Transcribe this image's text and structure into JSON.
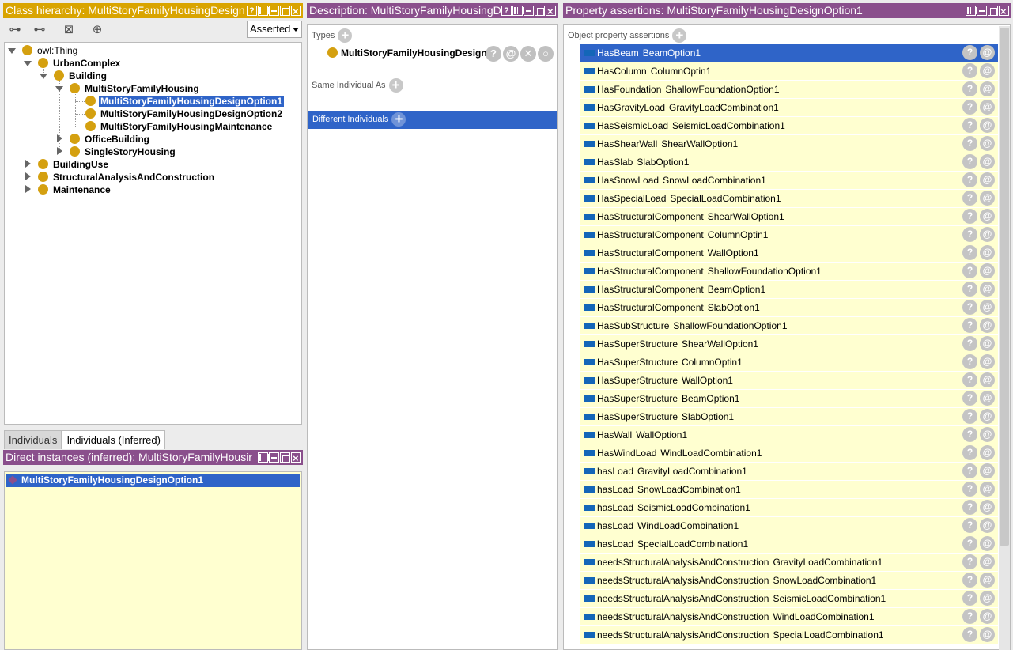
{
  "class_panel": {
    "title": "Class hierarchy: MultiStoryFamilyHousingDesign",
    "mode_select": "Asserted",
    "tree": [
      {
        "label": "owl:Thing",
        "depth": 0
      },
      {
        "label": "UrbanComplex",
        "depth": 1
      },
      {
        "label": "Building",
        "depth": 2
      },
      {
        "label": "MultiStoryFamilyHousing",
        "depth": 3
      },
      {
        "label": "MultiStoryFamilyHousingDesignOption1",
        "depth": 4
      },
      {
        "label": "MultiStoryFamilyHousingDesignOption2",
        "depth": 4
      },
      {
        "label": "MultiStoryFamilyHousingMaintenance",
        "depth": 4
      },
      {
        "label": "OfficeBuilding",
        "depth": 3
      },
      {
        "label": "SingleStoryHousing",
        "depth": 3
      },
      {
        "label": "BuildingUse",
        "depth": 1
      },
      {
        "label": "StructuralAnalysisAndConstruction",
        "depth": 1
      },
      {
        "label": "Maintenance",
        "depth": 1
      }
    ]
  },
  "individual_tabs": [
    "Individuals",
    "Individuals (Inferred)"
  ],
  "direct_panel": {
    "title": "Direct instances (inferred): MultiStoryFamilyHousir",
    "instance": "MultiStoryFamilyHousingDesignOption1"
  },
  "description_panel": {
    "title": "Description: MultiStoryFamilyHousingD",
    "types_label": "Types",
    "type_value": "MultiStoryFamilyHousingDesignO",
    "same_label": "Same Individual As",
    "different_label": "Different Individuals"
  },
  "property_panel": {
    "title": "Property assertions: MultiStoryFamilyHousingDesignOption1",
    "section_label": "Object property assertions",
    "rows": [
      {
        "prop": "HasBeam",
        "value": "BeamOption1"
      },
      {
        "prop": "HasColumn",
        "value": "ColumnOptin1"
      },
      {
        "prop": "HasFoundation",
        "value": "ShallowFoundationOption1"
      },
      {
        "prop": "HasGravityLoad",
        "value": "GravityLoadCombination1"
      },
      {
        "prop": "HasSeismicLoad",
        "value": "SeismicLoadCombination1"
      },
      {
        "prop": "HasShearWall",
        "value": "ShearWallOption1"
      },
      {
        "prop": "HasSlab",
        "value": "SlabOption1"
      },
      {
        "prop": "HasSnowLoad",
        "value": "SnowLoadCombination1"
      },
      {
        "prop": "HasSpecialLoad",
        "value": "SpecialLoadCombination1"
      },
      {
        "prop": "HasStructuralComponent",
        "value": "ShearWallOption1"
      },
      {
        "prop": "HasStructuralComponent",
        "value": "ColumnOptin1"
      },
      {
        "prop": "HasStructuralComponent",
        "value": "WallOption1"
      },
      {
        "prop": "HasStructuralComponent",
        "value": "ShallowFoundationOption1"
      },
      {
        "prop": "HasStructuralComponent",
        "value": "BeamOption1"
      },
      {
        "prop": "HasStructuralComponent",
        "value": "SlabOption1"
      },
      {
        "prop": "HasSubStructure",
        "value": "ShallowFoundationOption1"
      },
      {
        "prop": "HasSuperStructure",
        "value": "ShearWallOption1"
      },
      {
        "prop": "HasSuperStructure",
        "value": "ColumnOptin1"
      },
      {
        "prop": "HasSuperStructure",
        "value": "WallOption1"
      },
      {
        "prop": "HasSuperStructure",
        "value": "BeamOption1"
      },
      {
        "prop": "HasSuperStructure",
        "value": "SlabOption1"
      },
      {
        "prop": "HasWall",
        "value": "WallOption1"
      },
      {
        "prop": "HasWindLoad",
        "value": "WindLoadCombination1"
      },
      {
        "prop": "hasLoad",
        "value": "GravityLoadCombination1"
      },
      {
        "prop": "hasLoad",
        "value": "SnowLoadCombination1"
      },
      {
        "prop": "hasLoad",
        "value": "SeismicLoadCombination1"
      },
      {
        "prop": "hasLoad",
        "value": "WindLoadCombination1"
      },
      {
        "prop": "hasLoad",
        "value": "SpecialLoadCombination1"
      },
      {
        "prop": "needsStructuralAnalysisAndConstruction",
        "value": "GravityLoadCombination1"
      },
      {
        "prop": "needsStructuralAnalysisAndConstruction",
        "value": "SnowLoadCombination1"
      },
      {
        "prop": "needsStructuralAnalysisAndConstruction",
        "value": "SeismicLoadCombination1"
      },
      {
        "prop": "needsStructuralAnalysisAndConstruction",
        "value": "WindLoadCombination1"
      },
      {
        "prop": "needsStructuralAnalysisAndConstruction",
        "value": "SpecialLoadCombination1"
      }
    ]
  },
  "colors": {
    "class_accent": "#d9a400",
    "individual_accent": "#8a4f8c",
    "selection": "#2f64c8",
    "row_background": "#ffffd0"
  }
}
